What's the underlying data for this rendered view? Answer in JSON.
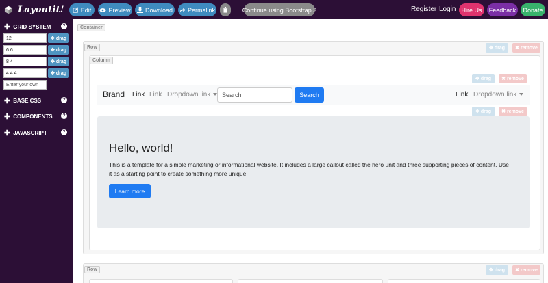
{
  "app": {
    "title": "Layoutit!"
  },
  "topbar": {
    "buttons": [
      {
        "icon": "edit-icon",
        "label": "Edit"
      },
      {
        "icon": "eye-icon",
        "label": "Preview"
      },
      {
        "icon": "download-icon",
        "label": "Download"
      },
      {
        "icon": "share-icon",
        "label": "Permalink"
      },
      {
        "icon": "trash-icon",
        "label": ""
      }
    ],
    "bootstrap_label": "Continue using Bootstrap 3",
    "register": "Register",
    "login": "Login",
    "hire": "Hire Us",
    "feedback": "Feedback",
    "donate": "Donate"
  },
  "sidebar": {
    "grid_system": "GRID SYSTEM",
    "grid_rows": [
      "12",
      "6 6",
      "8 4",
      "4 4 4"
    ],
    "drag_label": "drag",
    "custom_placeholder": "Enter your own",
    "sections": [
      "BASE CSS",
      "COMPONENTS",
      "JAVASCRIPT"
    ]
  },
  "canvas": {
    "container_tag": "Container",
    "row_tag": "Row",
    "column_tag": "Column",
    "drag": "drag",
    "remove": "remove"
  },
  "navbar": {
    "brand": "Brand",
    "link_active": "Link",
    "link": "Link",
    "dropdown": "Dropdown link",
    "search_placeholder": "Search",
    "search_button": "Search",
    "right_link": "Link",
    "right_dropdown": "Dropdown link"
  },
  "jumbotron": {
    "title": "Hello, world!",
    "text": "This is a template for a simple marketing or informational website. It includes a large callout called the hero unit and three supporting pieces of content. Use it as a starting point to create something more unique.",
    "button": "Learn more"
  },
  "colors": {
    "topbar_bg": "#2c0f36",
    "accent_blue": "#3f8bbf",
    "primary": "#1f7bf2",
    "hire": "#e0336e",
    "feedback": "#7b2ea5",
    "donate": "#38b26c"
  }
}
